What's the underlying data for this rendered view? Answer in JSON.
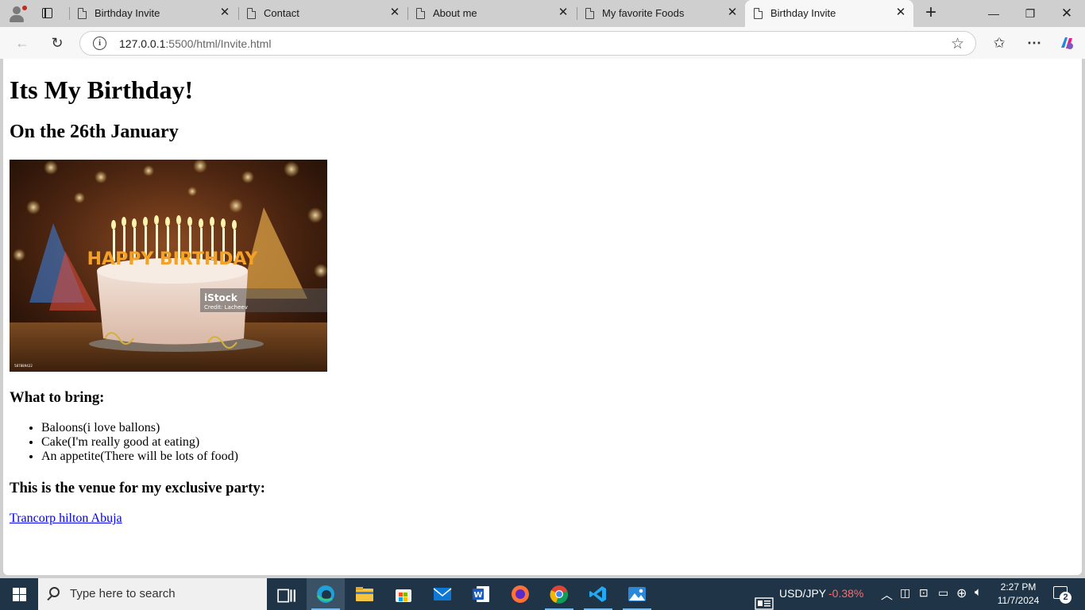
{
  "browser": {
    "tabs": [
      {
        "title": "Birthday Invite",
        "active": false
      },
      {
        "title": "Contact",
        "active": false
      },
      {
        "title": "About me",
        "active": false
      },
      {
        "title": "My favorite Foods",
        "active": false
      },
      {
        "title": "Birthday Invite",
        "active": true
      }
    ],
    "address_host": "127.0.0.1",
    "address_path": ":5500/html/Invite.html"
  },
  "page": {
    "heading": "Its My Birthday!",
    "subheading": "On the 26th January",
    "image_watermark": "iStock",
    "image_credit": "Credit: Lacheev",
    "image_id": "587889422",
    "cake_lettering": "HAPPY BIRTHDAY",
    "bring_heading": "What to bring:",
    "bring_items": [
      "Baloons(i love ballons)",
      "Cake(I'm really good at eating)",
      "An appetite(There will be lots of food)"
    ],
    "venue_heading": "This is the venue for my exclusive party:",
    "venue_link": "Trancorp hilton Abuja"
  },
  "taskbar": {
    "search_placeholder": "Type here to search",
    "ticker_label": "USD/JPY",
    "ticker_change": "-0.38%",
    "ticker_color": "#ff6b6b",
    "time": "2:27 PM",
    "date": "11/7/2024",
    "notification_count": "2"
  }
}
